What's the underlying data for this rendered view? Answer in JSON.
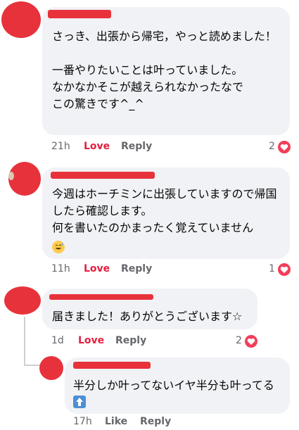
{
  "comments": [
    {
      "text": "さっき、出張から帰宅，やっと読めました！\n\n一番やりたいことは叶っていました。\nなかなかそこが越えられなかったなで\nこの驚きです^_^",
      "time": "21h",
      "love_label": "Love",
      "reply_label": "Reply",
      "reaction_count": "2"
    },
    {
      "text": "今週はホーチミンに出張していますので帰国したら確認します。\n何を書いたのかまったく覚えていません",
      "emoji": "smiling-face-with-sweat-emoji",
      "time": "11h",
      "love_label": "Love",
      "reply_label": "Reply",
      "reaction_count": "1"
    },
    {
      "text": "届きました！ありがとうございます☆",
      "time": "1d",
      "love_label": "Love",
      "reply_label": "Reply",
      "reaction_count": "2"
    },
    {
      "text": "半分しか叶ってないイヤ半分も叶ってる",
      "emoji": "up-arrow-emoji",
      "time": "17h",
      "like_label": "Like",
      "reply_label": "Reply"
    }
  ],
  "colors": {
    "bubble": "#f0f2f5",
    "love": "#e41e3f",
    "redaction": "#e8323b",
    "meta": "#65676b"
  }
}
